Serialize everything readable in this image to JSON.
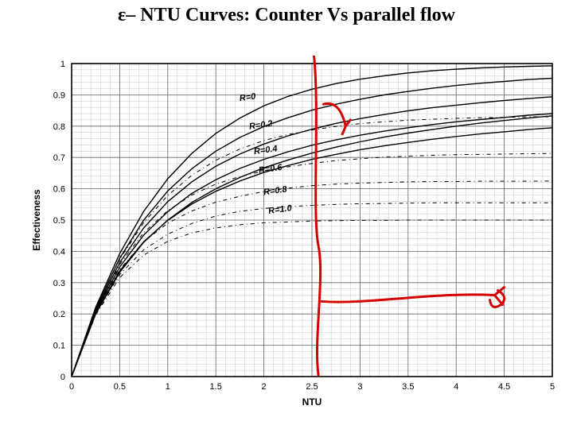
{
  "title": {
    "prefix": "ε– ",
    "text": "NTU Curves: Counter Vs parallel flow"
  },
  "axes": {
    "xlabel": "NTU",
    "ylabel": "Effectiveness",
    "xlim": [
      0,
      5
    ],
    "ylim": [
      0,
      1
    ],
    "xticks": [
      0,
      0.5,
      1,
      1.5,
      2,
      2.5,
      3,
      3.5,
      4,
      4.5,
      5
    ],
    "yticks": [
      0,
      0.1,
      0.2,
      0.3,
      0.4,
      0.5,
      0.6,
      0.7,
      0.8,
      0.9,
      1
    ]
  },
  "chart_data": {
    "type": "line",
    "title": "ε– NTU Curves: Counter Vs parallel flow",
    "xlabel": "NTU",
    "ylabel": "Effectiveness",
    "xlim": [
      0,
      5
    ],
    "ylim": [
      0,
      1
    ],
    "x": [
      0,
      0.25,
      0.5,
      0.75,
      1,
      1.25,
      1.5,
      1.75,
      2,
      2.25,
      2.5,
      2.75,
      3,
      3.25,
      3.5,
      3.75,
      4,
      4.25,
      4.5,
      4.75,
      5
    ],
    "series": [
      {
        "name": "R=0",
        "values": [
          0.0,
          0.221,
          0.393,
          0.528,
          0.632,
          0.713,
          0.777,
          0.826,
          0.865,
          0.895,
          0.918,
          0.936,
          0.95,
          0.961,
          0.97,
          0.977,
          0.982,
          0.986,
          0.989,
          0.991,
          0.993
        ]
      },
      {
        "name": "R=0.2",
        "values": [
          0.0,
          0.216,
          0.378,
          0.5,
          0.593,
          0.664,
          0.72,
          0.764,
          0.799,
          0.827,
          0.851,
          0.87,
          0.886,
          0.9,
          0.911,
          0.921,
          0.93,
          0.937,
          0.943,
          0.949,
          0.953
        ]
      },
      {
        "name": "R=0.4",
        "values": [
          0.0,
          0.211,
          0.364,
          0.475,
          0.559,
          0.622,
          0.672,
          0.711,
          0.743,
          0.769,
          0.79,
          0.809,
          0.824,
          0.837,
          0.849,
          0.859,
          0.867,
          0.875,
          0.882,
          0.888,
          0.894
        ]
      },
      {
        "name": "R=0.6",
        "values": [
          0.0,
          0.206,
          0.35,
          0.452,
          0.527,
          0.585,
          0.629,
          0.665,
          0.694,
          0.718,
          0.739,
          0.756,
          0.771,
          0.784,
          0.795,
          0.805,
          0.814,
          0.821,
          0.828,
          0.835,
          0.84
        ]
      },
      {
        "name": "R=0.8",
        "values": [
          0.0,
          0.201,
          0.337,
          0.431,
          0.499,
          0.551,
          0.592,
          0.625,
          0.652,
          0.674,
          0.694,
          0.71,
          0.725,
          0.737,
          0.748,
          0.758,
          0.767,
          0.775,
          0.782,
          0.789,
          0.795
        ]
      },
      {
        "name": "R=1.0",
        "values": [
          0.0,
          0.2,
          0.333,
          0.429,
          0.5,
          0.556,
          0.6,
          0.636,
          0.667,
          0.692,
          0.714,
          0.733,
          0.75,
          0.765,
          0.778,
          0.789,
          0.8,
          0.81,
          0.818,
          0.826,
          0.833
        ]
      }
    ],
    "series_dashed": [
      {
        "name": "R=0 (parallel)",
        "asymptote": 1.0,
        "values": [
          0.0,
          0.221,
          0.393,
          0.528,
          0.632,
          0.713,
          0.777,
          0.826,
          0.865,
          0.895,
          0.918,
          0.936,
          0.95,
          0.961,
          0.97,
          0.977,
          0.982,
          0.986,
          0.989,
          0.991,
          0.993
        ]
      },
      {
        "name": "R=0.2 (parallel)",
        "asymptote": 0.833,
        "values": [
          0.0,
          0.216,
          0.375,
          0.492,
          0.579,
          0.643,
          0.691,
          0.727,
          0.754,
          0.773,
          0.788,
          0.799,
          0.808,
          0.814,
          0.819,
          0.822,
          0.825,
          0.827,
          0.828,
          0.83,
          0.83
        ]
      },
      {
        "name": "R=0.4 (parallel)",
        "asymptote": 0.714,
        "values": [
          0.0,
          0.211,
          0.358,
          0.46,
          0.53,
          0.58,
          0.615,
          0.639,
          0.657,
          0.67,
          0.681,
          0.69,
          0.696,
          0.701,
          0.704,
          0.707,
          0.709,
          0.71,
          0.711,
          0.712,
          0.713
        ]
      },
      {
        "name": "R=0.6 (parallel)",
        "asymptote": 0.625,
        "values": [
          0.0,
          0.206,
          0.342,
          0.431,
          0.49,
          0.529,
          0.557,
          0.576,
          0.591,
          0.602,
          0.61,
          0.615,
          0.618,
          0.62,
          0.622,
          0.623,
          0.623,
          0.624,
          0.624,
          0.624,
          0.625
        ]
      },
      {
        "name": "R=0.8 (parallel)",
        "asymptote": 0.556,
        "values": [
          0.0,
          0.201,
          0.326,
          0.405,
          0.455,
          0.489,
          0.513,
          0.528,
          0.537,
          0.543,
          0.547,
          0.55,
          0.552,
          0.553,
          0.554,
          0.555,
          0.555,
          0.555,
          0.555,
          0.555,
          0.555
        ]
      },
      {
        "name": "R=1.0 (parallel)",
        "asymptote": 0.5,
        "values": [
          0.0,
          0.197,
          0.316,
          0.388,
          0.432,
          0.459,
          0.475,
          0.485,
          0.491,
          0.494,
          0.497,
          0.498,
          0.499,
          0.499,
          0.5,
          0.5,
          0.5,
          0.5,
          0.5,
          0.5,
          0.5
        ]
      }
    ],
    "series_label_positions": [
      {
        "name": "R=0",
        "x": 1.75,
        "y": 0.88
      },
      {
        "name": "R=0.2",
        "x": 1.85,
        "y": 0.79
      },
      {
        "name": "R=0.4",
        "x": 1.9,
        "y": 0.71
      },
      {
        "name": "R=0.6",
        "x": 1.95,
        "y": 0.65
      },
      {
        "name": "R=0.8",
        "x": 2.0,
        "y": 0.58
      },
      {
        "name": "R=1.0",
        "x": 2.05,
        "y": 0.52
      }
    ],
    "annotations": [
      {
        "kind": "vertical",
        "x": 2.55,
        "y0": 0.02,
        "y1": 1.02
      },
      {
        "kind": "arrow",
        "x0": 2.6,
        "y0": 0.24,
        "x1": 4.4,
        "y1": 0.26
      },
      {
        "kind": "curve_pointer",
        "x0": 2.62,
        "y0": 0.87,
        "x1": 2.85,
        "y1": 0.8
      }
    ]
  }
}
